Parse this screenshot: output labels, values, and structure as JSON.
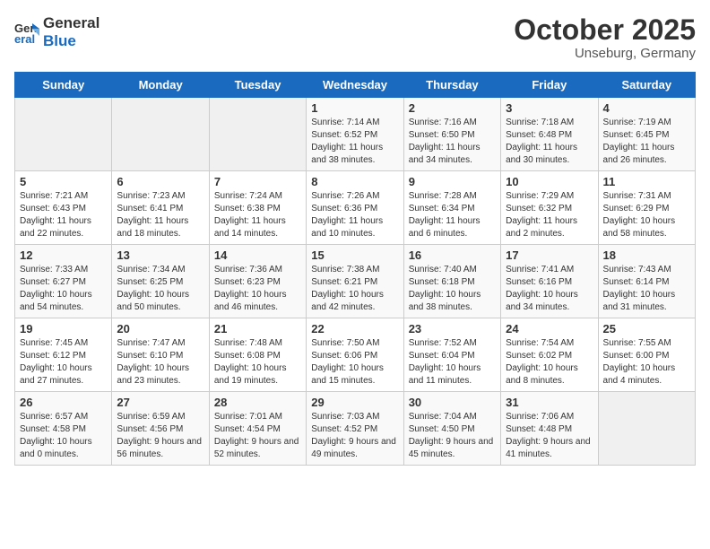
{
  "header": {
    "logo_line1": "General",
    "logo_line2": "Blue",
    "month_title": "October 2025",
    "subtitle": "Unseburg, Germany"
  },
  "days_of_week": [
    "Sunday",
    "Monday",
    "Tuesday",
    "Wednesday",
    "Thursday",
    "Friday",
    "Saturday"
  ],
  "weeks": [
    [
      {
        "day": "",
        "info": ""
      },
      {
        "day": "",
        "info": ""
      },
      {
        "day": "",
        "info": ""
      },
      {
        "day": "1",
        "info": "Sunrise: 7:14 AM\nSunset: 6:52 PM\nDaylight: 11 hours and 38 minutes."
      },
      {
        "day": "2",
        "info": "Sunrise: 7:16 AM\nSunset: 6:50 PM\nDaylight: 11 hours and 34 minutes."
      },
      {
        "day": "3",
        "info": "Sunrise: 7:18 AM\nSunset: 6:48 PM\nDaylight: 11 hours and 30 minutes."
      },
      {
        "day": "4",
        "info": "Sunrise: 7:19 AM\nSunset: 6:45 PM\nDaylight: 11 hours and 26 minutes."
      }
    ],
    [
      {
        "day": "5",
        "info": "Sunrise: 7:21 AM\nSunset: 6:43 PM\nDaylight: 11 hours and 22 minutes."
      },
      {
        "day": "6",
        "info": "Sunrise: 7:23 AM\nSunset: 6:41 PM\nDaylight: 11 hours and 18 minutes."
      },
      {
        "day": "7",
        "info": "Sunrise: 7:24 AM\nSunset: 6:38 PM\nDaylight: 11 hours and 14 minutes."
      },
      {
        "day": "8",
        "info": "Sunrise: 7:26 AM\nSunset: 6:36 PM\nDaylight: 11 hours and 10 minutes."
      },
      {
        "day": "9",
        "info": "Sunrise: 7:28 AM\nSunset: 6:34 PM\nDaylight: 11 hours and 6 minutes."
      },
      {
        "day": "10",
        "info": "Sunrise: 7:29 AM\nSunset: 6:32 PM\nDaylight: 11 hours and 2 minutes."
      },
      {
        "day": "11",
        "info": "Sunrise: 7:31 AM\nSunset: 6:29 PM\nDaylight: 10 hours and 58 minutes."
      }
    ],
    [
      {
        "day": "12",
        "info": "Sunrise: 7:33 AM\nSunset: 6:27 PM\nDaylight: 10 hours and 54 minutes."
      },
      {
        "day": "13",
        "info": "Sunrise: 7:34 AM\nSunset: 6:25 PM\nDaylight: 10 hours and 50 minutes."
      },
      {
        "day": "14",
        "info": "Sunrise: 7:36 AM\nSunset: 6:23 PM\nDaylight: 10 hours and 46 minutes."
      },
      {
        "day": "15",
        "info": "Sunrise: 7:38 AM\nSunset: 6:21 PM\nDaylight: 10 hours and 42 minutes."
      },
      {
        "day": "16",
        "info": "Sunrise: 7:40 AM\nSunset: 6:18 PM\nDaylight: 10 hours and 38 minutes."
      },
      {
        "day": "17",
        "info": "Sunrise: 7:41 AM\nSunset: 6:16 PM\nDaylight: 10 hours and 34 minutes."
      },
      {
        "day": "18",
        "info": "Sunrise: 7:43 AM\nSunset: 6:14 PM\nDaylight: 10 hours and 31 minutes."
      }
    ],
    [
      {
        "day": "19",
        "info": "Sunrise: 7:45 AM\nSunset: 6:12 PM\nDaylight: 10 hours and 27 minutes."
      },
      {
        "day": "20",
        "info": "Sunrise: 7:47 AM\nSunset: 6:10 PM\nDaylight: 10 hours and 23 minutes."
      },
      {
        "day": "21",
        "info": "Sunrise: 7:48 AM\nSunset: 6:08 PM\nDaylight: 10 hours and 19 minutes."
      },
      {
        "day": "22",
        "info": "Sunrise: 7:50 AM\nSunset: 6:06 PM\nDaylight: 10 hours and 15 minutes."
      },
      {
        "day": "23",
        "info": "Sunrise: 7:52 AM\nSunset: 6:04 PM\nDaylight: 10 hours and 11 minutes."
      },
      {
        "day": "24",
        "info": "Sunrise: 7:54 AM\nSunset: 6:02 PM\nDaylight: 10 hours and 8 minutes."
      },
      {
        "day": "25",
        "info": "Sunrise: 7:55 AM\nSunset: 6:00 PM\nDaylight: 10 hours and 4 minutes."
      }
    ],
    [
      {
        "day": "26",
        "info": "Sunrise: 6:57 AM\nSunset: 4:58 PM\nDaylight: 10 hours and 0 minutes."
      },
      {
        "day": "27",
        "info": "Sunrise: 6:59 AM\nSunset: 4:56 PM\nDaylight: 9 hours and 56 minutes."
      },
      {
        "day": "28",
        "info": "Sunrise: 7:01 AM\nSunset: 4:54 PM\nDaylight: 9 hours and 52 minutes."
      },
      {
        "day": "29",
        "info": "Sunrise: 7:03 AM\nSunset: 4:52 PM\nDaylight: 9 hours and 49 minutes."
      },
      {
        "day": "30",
        "info": "Sunrise: 7:04 AM\nSunset: 4:50 PM\nDaylight: 9 hours and 45 minutes."
      },
      {
        "day": "31",
        "info": "Sunrise: 7:06 AM\nSunset: 4:48 PM\nDaylight: 9 hours and 41 minutes."
      },
      {
        "day": "",
        "info": ""
      }
    ]
  ]
}
